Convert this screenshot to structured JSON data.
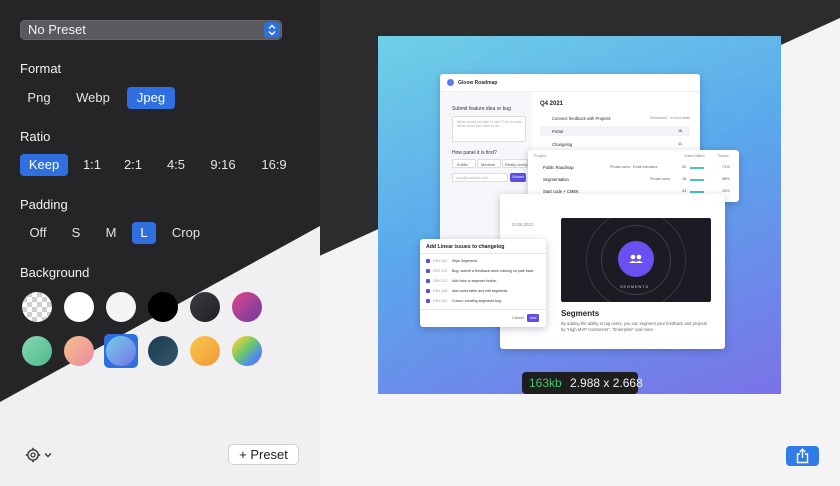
{
  "preset": {
    "value": "No Preset"
  },
  "format": {
    "label": "Format",
    "options": [
      "Png",
      "Webp",
      "Jpeg"
    ],
    "selected": "Jpeg"
  },
  "ratio": {
    "label": "Ratio",
    "options": [
      "Keep",
      "1:1",
      "2:1",
      "4:5",
      "9:16",
      "16:9"
    ],
    "selected": "Keep"
  },
  "padding": {
    "label": "Padding",
    "options": [
      "Off",
      "S",
      "M",
      "L",
      "Crop"
    ],
    "selected": "L"
  },
  "background": {
    "label": "Background",
    "swatches": [
      "transparent-checker",
      "#ffffff",
      "#f4f4f6",
      "#000000",
      "#2f3034",
      "#c0468e",
      "#6ecba0",
      "#f5a98a",
      "#5aa8ec",
      "#2a4a5e",
      "#f0a840",
      "rainbow"
    ],
    "selected_index": 8
  },
  "footer": {
    "preset_button": "+ Preset"
  },
  "image_info": {
    "size": "163kb",
    "dimensions": "2.988 x 2.668"
  },
  "colors": {
    "accent": "#2f6fe0",
    "panel": "#252528",
    "size_green": "#4cc06a"
  },
  "preview": {
    "app_title": "Gloow Roadmap",
    "feedback_prompt": "Submit feature idea or bug",
    "feedback_placeholder": "What would you like to see? Tell us more about what you want to do...",
    "panel_question": "How panel it is first?",
    "panel_options": [
      "A little",
      "Medium",
      "Really lovely"
    ],
    "email_placeholder": "your@example.com",
    "submit": "Submit",
    "quarter": "Q4 2021",
    "roadmap_items": [
      "Connect feedback with Projects",
      "Portal",
      "Changelog"
    ],
    "roadmap_status": "Scheduled · In next week",
    "roadmap_counts": [
      "16",
      "11"
    ],
    "table_headers": [
      "Project",
      "Votes tallied",
      "Status"
    ],
    "projects": [
      {
        "name": "Public Roadmap",
        "tags": "Private users · Email interactive",
        "votes": "32",
        "status": "71%"
      },
      {
        "name": "Segmentation",
        "tags": "Private users",
        "votes": "18",
        "status": "98%"
      },
      {
        "name": "Start code + CMEK",
        "tags": "",
        "votes": "34",
        "status": "12%"
      }
    ],
    "changelog_date": "23.06.2022",
    "segments_badge": "SEGMENTS",
    "segments_title": "Segments",
    "segments_text": "By adding the ability to tag users, you can segment your feedback and projects by \"High MVP Customers\", \"Enterprise\" and more.",
    "linear_title": "Add Linear issues to changelog",
    "linear_items": [
      {
        "id": "DEV-192",
        "text": "Style Segments"
      },
      {
        "id": "DEV-103",
        "text": "Bug: submit a feedback when clicking on pale base"
      },
      {
        "id": "DEV-123",
        "text": "Add links to segment button"
      },
      {
        "id": "DEV-128",
        "text": "Add users table and edit segments"
      },
      {
        "id": "DEV-132",
        "text": "Cursor: creating segments bug"
      }
    ],
    "cancel": "Cancel",
    "add": "Add"
  }
}
